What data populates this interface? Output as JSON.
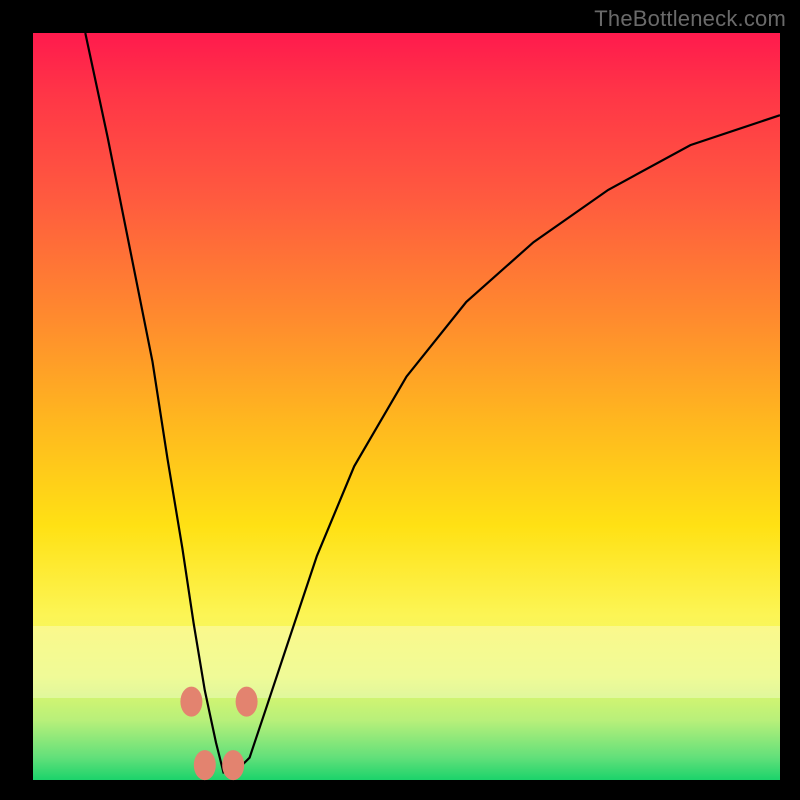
{
  "watermark": "TheBottleneck.com",
  "chart_data": {
    "type": "line",
    "title": "",
    "xlabel": "",
    "ylabel": "",
    "xlim": [
      0,
      100
    ],
    "ylim": [
      0,
      100
    ],
    "grid": false,
    "legend": false,
    "note": "Values are read off pixel positions; no numeric axes are shown, so x and y are expressed as 0–100% of the plot area, y increasing upward.",
    "series": [
      {
        "name": "bottleneck-curve",
        "x": [
          7,
          10,
          13,
          16,
          18,
          20,
          21.5,
          23,
          24.5,
          25.5,
          27,
          29,
          31,
          34,
          38,
          43,
          50,
          58,
          67,
          77,
          88,
          100
        ],
        "y": [
          100,
          86,
          71,
          56,
          43,
          31,
          21,
          12,
          5,
          1,
          1,
          3,
          9,
          18,
          30,
          42,
          54,
          64,
          72,
          79,
          85,
          89
        ]
      }
    ],
    "markers": [
      {
        "x": 21.2,
        "y": 10.5
      },
      {
        "x": 23.0,
        "y": 2.0
      },
      {
        "x": 26.8,
        "y": 2.0
      },
      {
        "x": 28.6,
        "y": 10.5
      }
    ],
    "colors": {
      "curve": "#000000",
      "marker": "#e3836f",
      "gradient_top": "#ff1a4d",
      "gradient_mid": "#ffe114",
      "gradient_bottom": "#1bd36b"
    }
  }
}
